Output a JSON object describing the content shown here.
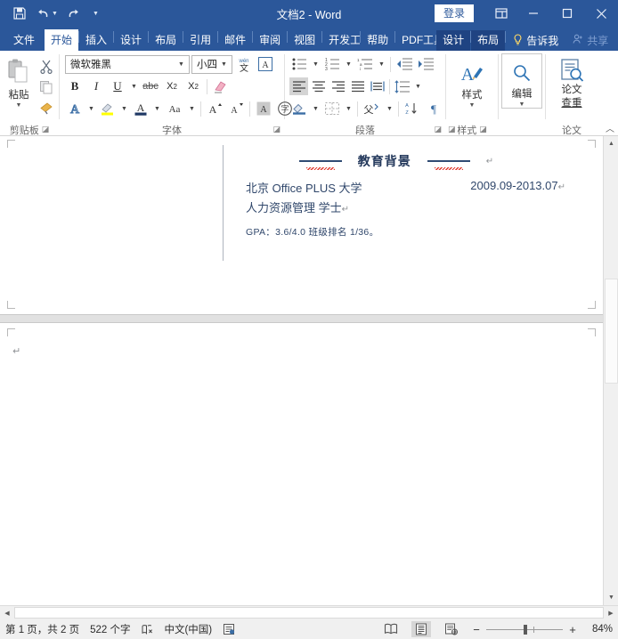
{
  "titlebar": {
    "document_title": "文档2  -  Word",
    "signin_label": "登录",
    "quick_access": [
      {
        "name": "save",
        "label": "保存"
      },
      {
        "name": "undo",
        "label": "撤消"
      },
      {
        "name": "redo",
        "label": "恢复"
      },
      {
        "name": "customize",
        "label": "自定义快速访问工具栏"
      }
    ],
    "window_controls": [
      {
        "name": "ribbon-display-options",
        "label": "功能区显示选项"
      },
      {
        "name": "minimize",
        "label": "最小化"
      },
      {
        "name": "maximize",
        "label": "最大化"
      },
      {
        "name": "close",
        "label": "关闭"
      }
    ]
  },
  "tabs": [
    {
      "label": "文件",
      "state": "file"
    },
    {
      "label": "开始",
      "state": "active"
    },
    {
      "label": "插入",
      "state": "normal"
    },
    {
      "label": "设计",
      "state": "normal"
    },
    {
      "label": "布局",
      "state": "normal"
    },
    {
      "label": "引用",
      "state": "normal"
    },
    {
      "label": "邮件",
      "state": "normal"
    },
    {
      "label": "审阅",
      "state": "normal"
    },
    {
      "label": "视图",
      "state": "normal"
    },
    {
      "label": "开发工具",
      "state": "normal"
    },
    {
      "label": "帮助",
      "state": "normal"
    },
    {
      "label": "PDF工具集",
      "state": "normal"
    },
    {
      "label": "设计",
      "state": "contextual"
    },
    {
      "label": "布局",
      "state": "contextual"
    }
  ],
  "tellme_label": "告诉我",
  "share_label": "共享",
  "ribbon": {
    "clipboard": {
      "group_label": "剪贴板",
      "paste_label": "粘贴",
      "items": [
        {
          "name": "cut",
          "label": "剪切"
        },
        {
          "name": "copy",
          "label": "复制"
        },
        {
          "name": "format-painter",
          "label": "格式刷"
        }
      ]
    },
    "font": {
      "group_label": "字体",
      "font_name": "微软雅黑",
      "font_size": "小四",
      "buttons": [
        {
          "name": "bold",
          "glyph": "B"
        },
        {
          "name": "italic",
          "glyph": "I"
        },
        {
          "name": "underline",
          "glyph": "U"
        },
        {
          "name": "strikethrough",
          "glyph": "abc"
        },
        {
          "name": "subscript",
          "glyph": "X₂"
        },
        {
          "name": "superscript",
          "glyph": "X²"
        }
      ]
    },
    "paragraph": {
      "group_label": "段落"
    },
    "styles": {
      "group_label": "样式",
      "button_label": "样式"
    },
    "editing": {
      "group_label": "",
      "button_label": "编辑"
    },
    "thesis": {
      "group_label": "论文",
      "button_label_line1": "论文",
      "button_label_line2": "查重"
    }
  },
  "document": {
    "heading": "教育背景",
    "school": "北京 Office PLUS 大学",
    "degree": "人力资源管理 学士",
    "date_range": "2009.09-2013.07",
    "gpa_line": "GPA：3.6/4.0   班级排名 1/36。",
    "pilcrow": "↵"
  },
  "statusbar": {
    "page_info": "第 1 页，共 2 页",
    "word_count": "522 个字",
    "proofing_label": "校对",
    "language": "中文(中国)",
    "accessibility_label": "辅助功能",
    "views": [
      {
        "name": "read-mode",
        "label": "阅读视图",
        "active": false
      },
      {
        "name": "print-layout",
        "label": "页面视图",
        "active": true
      },
      {
        "name": "web-layout",
        "label": "Web 版式视图",
        "active": false
      }
    ],
    "zoom_percent": "84%",
    "zoom_out_label": "缩小",
    "zoom_in_label": "放大"
  },
  "colors": {
    "brand": "#2b579a",
    "contextual_tab": "#1f4382",
    "doc_text": "#30476b",
    "heading": "#24395c",
    "accent_rule": "#2f4b73",
    "spell_error": "#e03c31"
  }
}
